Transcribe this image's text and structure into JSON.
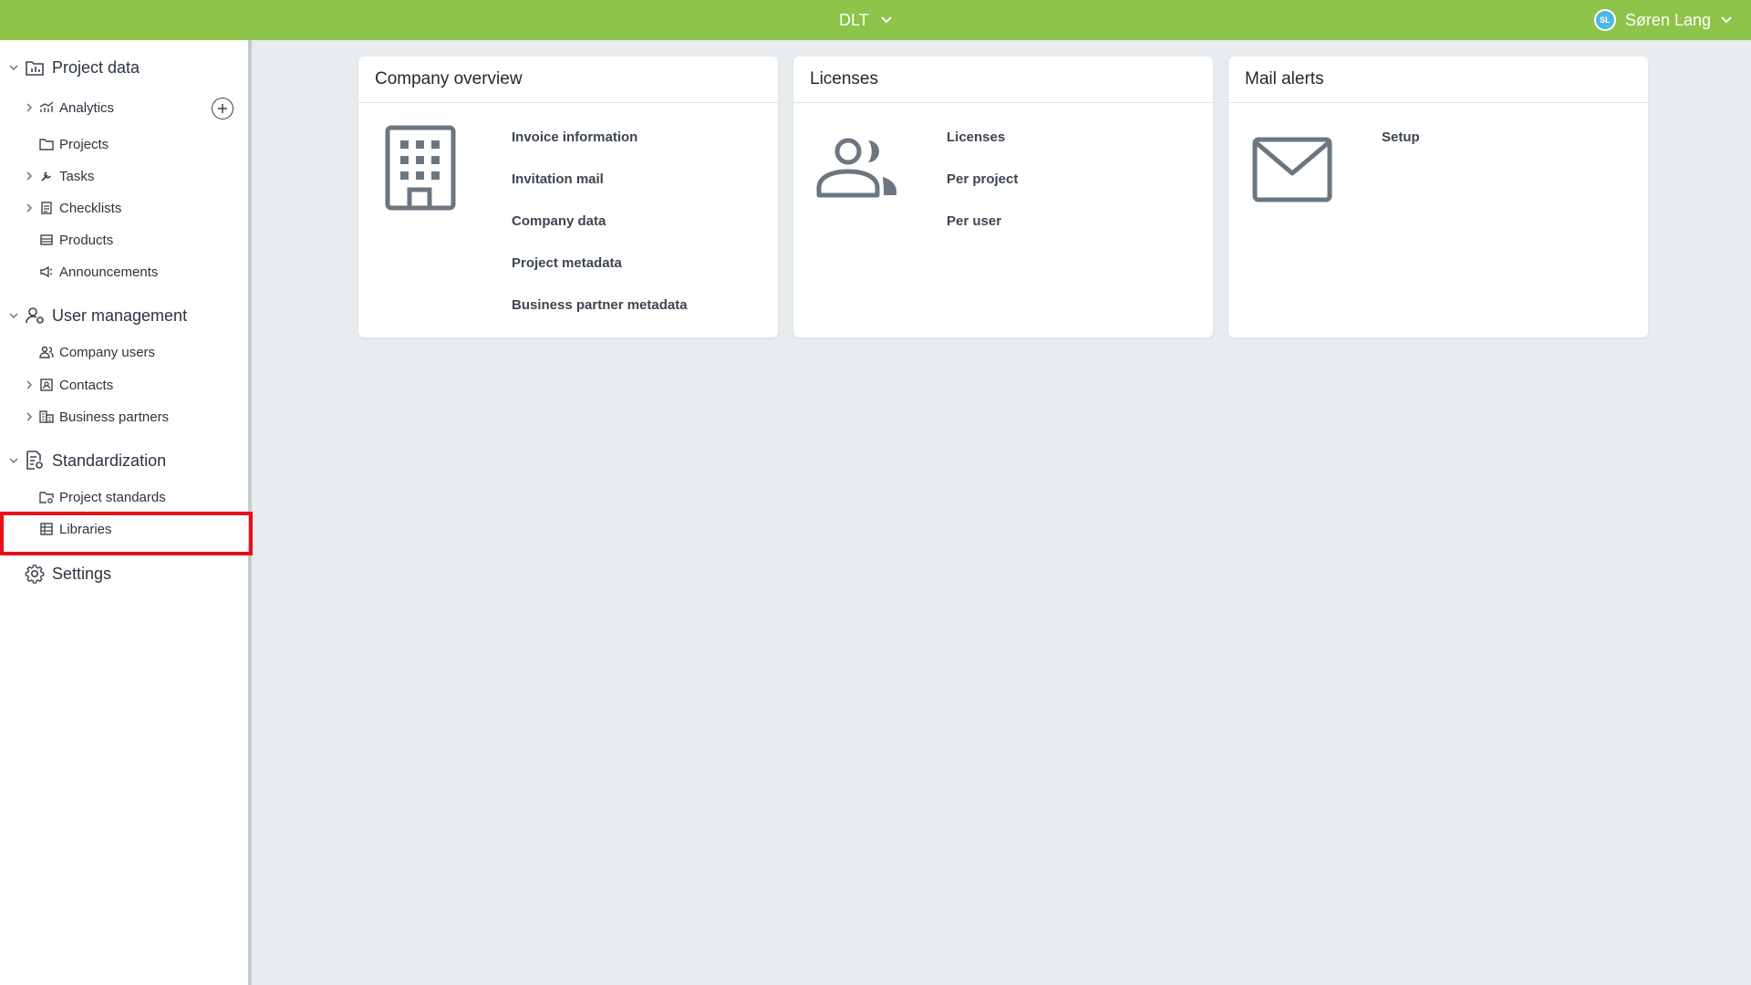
{
  "topbar": {
    "company": "DLT",
    "user_initials": "SL",
    "user_name": "Søren Lang",
    "color": "#8dc449"
  },
  "sidebar": {
    "groups": {
      "project_data": {
        "label": "Project data",
        "items": {
          "analytics": "Analytics",
          "projects": "Projects",
          "tasks": "Tasks",
          "checklists": "Checklists",
          "products": "Products",
          "announcements": "Announcements"
        }
      },
      "user_management": {
        "label": "User management",
        "items": {
          "company_users": "Company users",
          "contacts": "Contacts",
          "business_partners": "Business partners"
        }
      },
      "standardization": {
        "label": "Standardization",
        "items": {
          "project_standards": "Project standards",
          "libraries": "Libraries"
        }
      },
      "settings": {
        "label": "Settings"
      }
    },
    "highlight_color": "#e8101a"
  },
  "cards": {
    "company_overview": {
      "title": "Company overview",
      "icon": "building-icon",
      "links": [
        "Invoice information",
        "Invitation mail",
        "Company data",
        "Project metadata",
        "Business partner metadata"
      ]
    },
    "licenses": {
      "title": "Licenses",
      "icon": "users-icon",
      "links": [
        "Licenses",
        "Per project",
        "Per user"
      ]
    },
    "mail_alerts": {
      "title": "Mail alerts",
      "icon": "envelope-icon",
      "links": [
        "Setup"
      ]
    }
  }
}
